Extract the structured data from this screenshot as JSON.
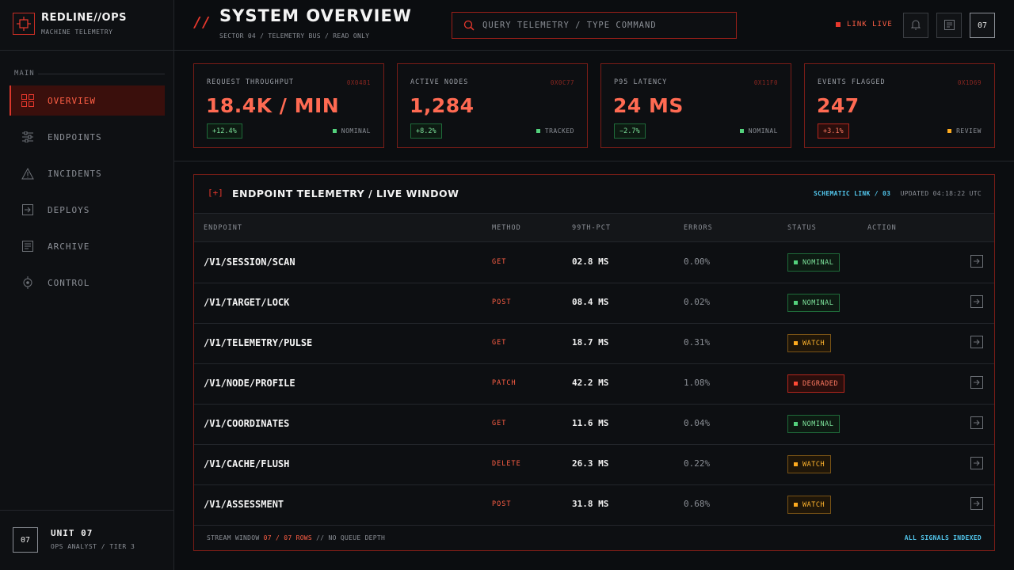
{
  "brand": {
    "name": "REDLINE//OPS",
    "subtitle": "MACHINE TELEMETRY"
  },
  "sidebar": {
    "section": "MAIN",
    "items": [
      {
        "label": "OVERVIEW",
        "icon": "grid-icon",
        "active": true
      },
      {
        "label": "ENDPOINTS",
        "icon": "sliders-icon",
        "active": false
      },
      {
        "label": "INCIDENTS",
        "icon": "warning-icon",
        "active": false
      },
      {
        "label": "DEPLOYS",
        "icon": "deploy-icon",
        "active": false
      },
      {
        "label": "ARCHIVE",
        "icon": "archive-icon",
        "active": false
      },
      {
        "label": "CONTROL",
        "icon": "target-icon",
        "active": false
      }
    ],
    "unit": {
      "badge": "07",
      "name": "UNIT 07",
      "role": "OPS ANALYST / TIER 3"
    }
  },
  "header": {
    "slash": "//",
    "title": "SYSTEM OVERVIEW",
    "subtitle": "SECTOR 04 / TELEMETRY BUS / READ ONLY",
    "search_placeholder": "QUERY TELEMETRY / TYPE COMMAND",
    "link_status": "LINK LIVE",
    "user_badge": "07"
  },
  "stats": [
    {
      "label": "REQUEST THROUGHPUT",
      "code": "0X0481",
      "value": "18.4K / MIN",
      "delta": "+12.4%",
      "delta_type": "up",
      "status": "NOMINAL",
      "status_color": "#53d17c"
    },
    {
      "label": "ACTIVE NODES",
      "code": "0X0C77",
      "value": "1,284",
      "delta": "+8.2%",
      "delta_type": "up",
      "status": "TRACKED",
      "status_color": "#53d17c"
    },
    {
      "label": "P95 LATENCY",
      "code": "0X11F0",
      "value": "24 MS",
      "delta": "−2.7%",
      "delta_type": "up",
      "status": "NOMINAL",
      "status_color": "#53d17c"
    },
    {
      "label": "EVENTS FLAGGED",
      "code": "0X1D69",
      "value": "247",
      "delta": "+3.1%",
      "delta_type": "warn",
      "status": "REVIEW",
      "status_color": "#ffab1f"
    }
  ],
  "panel": {
    "tag": "[+]",
    "title": "ENDPOINT TELEMETRY / LIVE WINDOW",
    "schematic_link": "SCHEMATIC LINK / 03",
    "updated": "UPDATED 04:18:22 UTC",
    "columns": [
      "ENDPOINT",
      "METHOD",
      "99TH-PCT",
      "ERRORS",
      "STATUS",
      "ACTION"
    ],
    "rows": [
      {
        "endpoint": "/V1/SESSION/SCAN",
        "method": "GET",
        "pct": "02.8 MS",
        "errors": "0.00%",
        "status": "NOMINAL",
        "status_type": "nominal"
      },
      {
        "endpoint": "/V1/TARGET/LOCK",
        "method": "POST",
        "pct": "08.4 MS",
        "errors": "0.02%",
        "status": "NOMINAL",
        "status_type": "nominal"
      },
      {
        "endpoint": "/V1/TELEMETRY/PULSE",
        "method": "GET",
        "pct": "18.7 MS",
        "errors": "0.31%",
        "status": "WATCH",
        "status_type": "watch"
      },
      {
        "endpoint": "/V1/NODE/PROFILE",
        "method": "PATCH",
        "pct": "42.2 MS",
        "errors": "1.08%",
        "status": "DEGRADED",
        "status_type": "degraded"
      },
      {
        "endpoint": "/V1/COORDINATES",
        "method": "GET",
        "pct": "11.6 MS",
        "errors": "0.04%",
        "status": "NOMINAL",
        "status_type": "nominal"
      },
      {
        "endpoint": "/V1/CACHE/FLUSH",
        "method": "DELETE",
        "pct": "26.3 MS",
        "errors": "0.22%",
        "status": "WATCH",
        "status_type": "watch"
      },
      {
        "endpoint": "/V1/ASSESSMENT",
        "method": "POST",
        "pct": "31.8 MS",
        "errors": "0.68%",
        "status": "WATCH",
        "status_type": "watch"
      }
    ],
    "footer_prefix": "STREAM WINDOW",
    "footer_rows": "07 / 07 ROWS",
    "footer_suffix": "// NO QUEUE DEPTH",
    "footer_right": "ALL SIGNALS INDEXED"
  },
  "colors": {
    "accent": "#e8382d",
    "accent_text": "#ff5f45",
    "link": "#52c6ec",
    "nominal": "#53d17c",
    "watch": "#ffab1f"
  }
}
